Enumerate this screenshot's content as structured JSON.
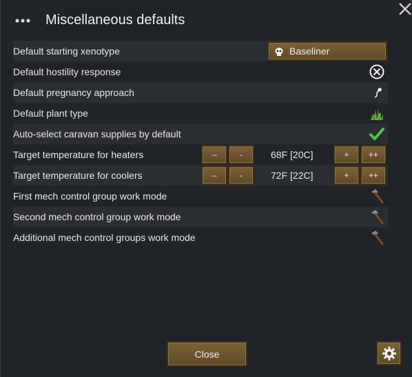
{
  "window": {
    "title": "Miscellaneous defaults"
  },
  "rows": [
    {
      "label": "Default starting xenotype",
      "value": "Baseliner",
      "icon": "skull-icon"
    },
    {
      "label": "Default hostility response",
      "icon": "hostility-circle-x-icon"
    },
    {
      "label": "Default pregnancy approach",
      "icon": "sperm-icon"
    },
    {
      "label": "Default plant type",
      "icon": "grass-plant-icon"
    },
    {
      "label": "Auto-select caravan supplies by default",
      "icon": "checkmark-icon"
    },
    {
      "label": "Target temperature for heaters",
      "value": "68F [20C]",
      "buttons": [
        "--",
        "-",
        "+",
        "++"
      ]
    },
    {
      "label": "Target temperature for coolers",
      "value": "72F [22C]",
      "buttons": [
        "--",
        "-",
        "+",
        "++"
      ]
    },
    {
      "label": "First mech control group work mode",
      "icon": "hammer-icon"
    },
    {
      "label": "Second mech control group work mode",
      "icon": "hammer-icon"
    },
    {
      "label": "Additional mech control groups work mode",
      "icon": "hammer-icon"
    }
  ],
  "footer": {
    "close_label": "Close"
  },
  "colors": {
    "background": "#202327",
    "row_alt": "#2a2d31",
    "button": "#6b5530",
    "check": "#3fcf3f"
  }
}
